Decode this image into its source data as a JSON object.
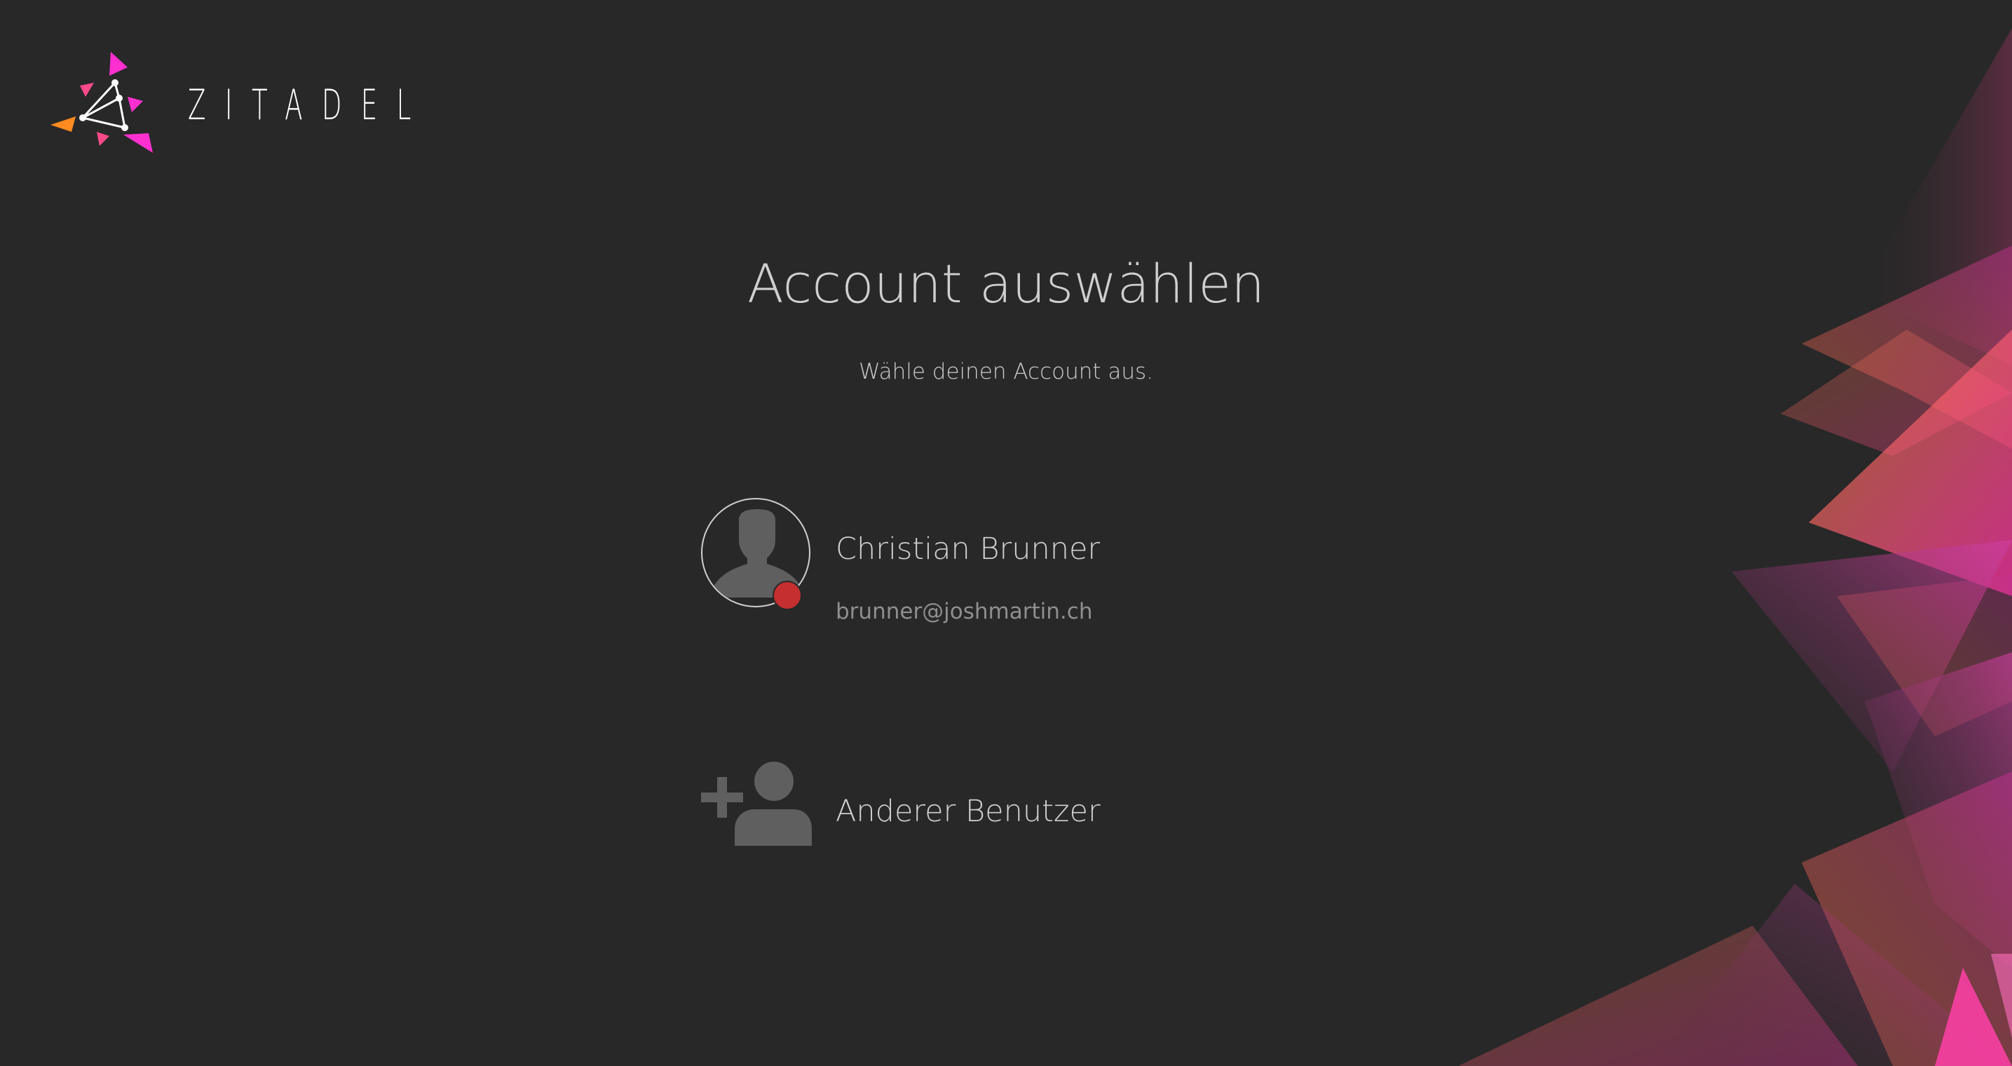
{
  "brand": {
    "name": "ZITADEL"
  },
  "header": {
    "title": "Account auswählen",
    "subtitle": "Wähle deinen Account aus."
  },
  "accounts": [
    {
      "name": "Christian Brunner",
      "email": "brunner@joshmartin.ch",
      "status_color": "#c62f2f",
      "icon": "person-silhouette-icon"
    }
  ],
  "other_user": {
    "label": "Anderer Benutzer",
    "icon": "add-person-icon"
  },
  "colors": {
    "background": "#282828",
    "accent_pink": "#ff2fd0",
    "accent_orange": "#ff8a1f"
  }
}
